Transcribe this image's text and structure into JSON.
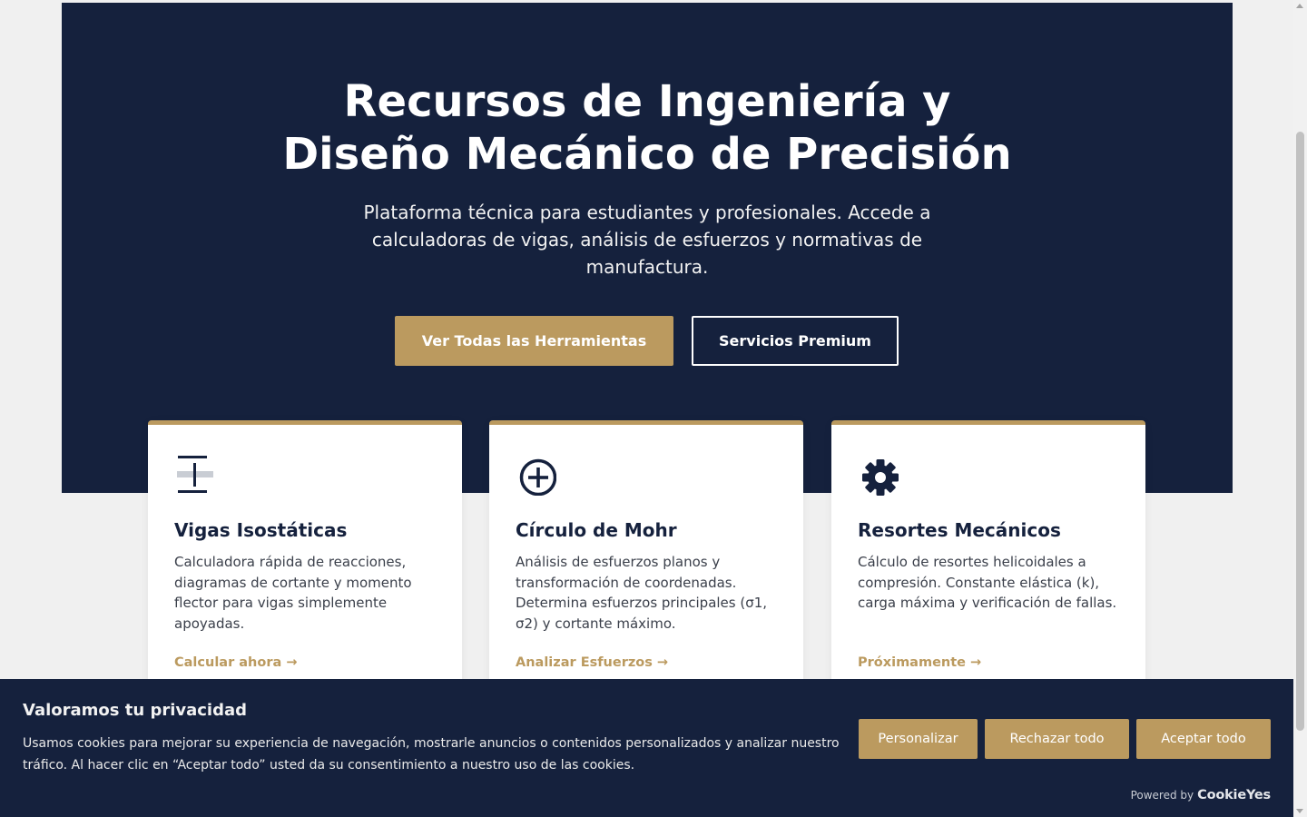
{
  "hero": {
    "title_line1": "Recursos de Ingeniería y",
    "title_line2": "Diseño Mecánico de Precisión",
    "subtitle": "Plataforma técnica para estudiantes y profesionales. Accede a calculadoras de vigas, análisis de esfuerzos y normativas de manufactura.",
    "primary_button": "Ver Todas las Herramientas",
    "secondary_button": "Servicios Premium"
  },
  "cards": [
    {
      "icon": "beam-icon",
      "title": "Vigas Isostáticas",
      "description": "Calculadora rápida de reacciones, diagramas de cortante y momento flector para vigas simplemente apoyadas.",
      "link": "Calcular ahora →"
    },
    {
      "icon": "circle-plus-icon",
      "title": "Círculo de Mohr",
      "description": "Análisis de esfuerzos planos y transformación de coordenadas. Determina esfuerzos principales (σ1, σ2) y cortante máximo.",
      "link": "Analizar Esfuerzos →"
    },
    {
      "icon": "gear-icon",
      "title": "Resortes Mecánicos",
      "description": "Cálculo de resortes helicoidales a compresión. Constante elástica (k), carga máxima y verificación de fallas.",
      "link": "Próximamente →"
    }
  ],
  "cookie_banner": {
    "title": "Valoramos tu privacidad",
    "text": "Usamos cookies para mejorar su experiencia de navegación, mostrarle anuncios o contenidos personalizados y analizar nuestro tráfico. Al hacer clic en “Aceptar todo” usted da su consentimiento a nuestro uso de las cookies.",
    "customize": "Personalizar",
    "reject": "Rechazar todo",
    "accept": "Aceptar todo",
    "powered_by": "Powered by",
    "brand": "CookieYes"
  },
  "colors": {
    "navy": "#15213d",
    "gold": "#bb9a5f",
    "background": "#f0f0f0"
  }
}
